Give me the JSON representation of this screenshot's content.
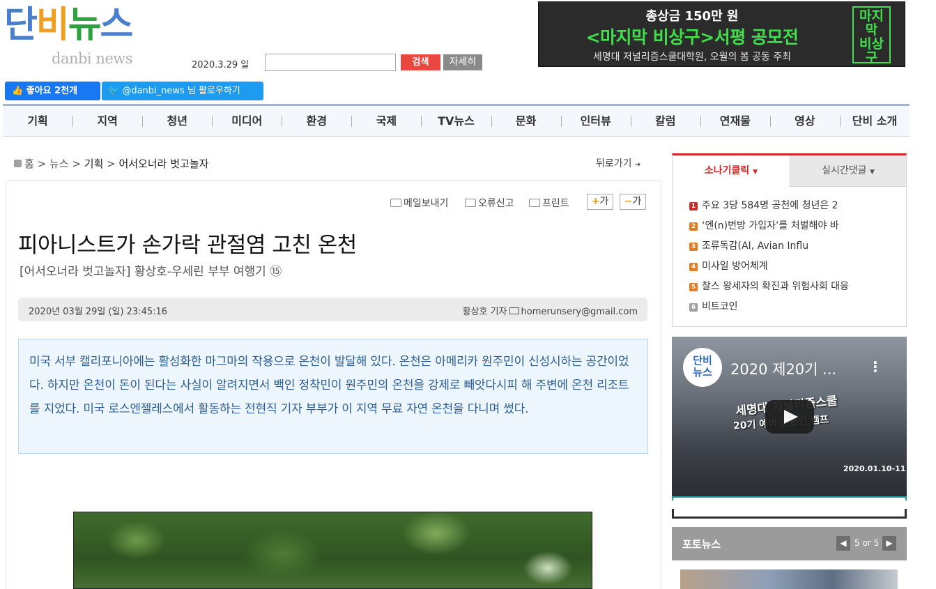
{
  "header": {
    "logo_text": "단비뉴스",
    "logo_sub": "danbi news",
    "date": "2020.3.29 일",
    "search_placeholder": "",
    "search_button": "검색",
    "detail_button": "자세히",
    "facebook_label": "좋아요 2천개",
    "twitter_label": "@danbi_news 님 팔로우하기"
  },
  "banner": {
    "line1": "총상금 150만 원",
    "line2": "<마지막 비상구>서평 공모전",
    "line3": "세명대 저널리즘스쿨대학원, 오월의 봄 공동 주최",
    "vertical": "마지막\n비상구"
  },
  "nav": {
    "items": [
      "기획",
      "지역",
      "청년",
      "미디어",
      "환경",
      "국제",
      "TV뉴스",
      "문화",
      "인터뷰",
      "칼럼",
      "연재물",
      "영상",
      "단비 소개"
    ]
  },
  "breadcrumb": {
    "home": "홈",
    "sep": ">",
    "news": "뉴스",
    "section": "기획",
    "series": "어서오너라 벗고놀자",
    "back": "뒤로가기"
  },
  "article": {
    "tools": {
      "mail": "메일보내기",
      "report": "오류신고",
      "print": "프린트",
      "font_up": "가",
      "font_down": "가"
    },
    "title": "피아니스트가 손가락 관절염 고친 온천",
    "subtitle": "[어서오너라 벗고놀자] 황상호-우세린 부부 여행기 ⑮",
    "date": "2020년 03월 29일 (일) 23:45:16",
    "author": "황상호 기자",
    "email": "homerunsery@gmail.com",
    "lead": "미국 서부 캘리포니아에는 활성화한 마그마의 작용으로 온천이 발달해 있다. 온천은 아메리카 원주민이 신성시하는 공간이었다. 하지만 온천이 돈이 된다는 사실이 알려지면서 백인 정착민이 원주민의 온천을 강제로 빼앗다시피 해 주변에 온천 리조트를 지었다. 미국 로스엔젤레스에서 활동하는 전현직 기자 부부가 이 지역 무료 자연 온천을 다니며 썼다."
  },
  "sidebar": {
    "tab_popular": "소나기클릭",
    "tab_comments": "실시간댓글",
    "ranking": [
      {
        "num": "1",
        "title": "주요 3당 584명 공천에 청년은 2"
      },
      {
        "num": "2",
        "title": "‘엔(n)번방 가입자’를 처벌해야 바"
      },
      {
        "num": "3",
        "title": "조류독감(AI, Avian Influ"
      },
      {
        "num": "4",
        "title": "미사일 방어체계"
      },
      {
        "num": "5",
        "title": "찰스 왕세자의 확진과 위험사회 대응"
      },
      {
        "num": "6",
        "title": "비트코인"
      }
    ],
    "rank_colors": [
      "#c9302c",
      "#e57a1f",
      "#e57a1f",
      "#e57a1f",
      "#e57a1f",
      "#9e9e9e"
    ],
    "video": {
      "channel": "단비\n뉴스",
      "title": "2020 제20기 ...",
      "caption1": "세명대 저널리즘스쿨",
      "caption2": "20기 예비 언론인 캠프",
      "date": "2020.01.10-11"
    },
    "photo_news": {
      "title": "포토뉴스",
      "pager": "5 or 5",
      "prev": "◀",
      "next": "▶"
    }
  }
}
